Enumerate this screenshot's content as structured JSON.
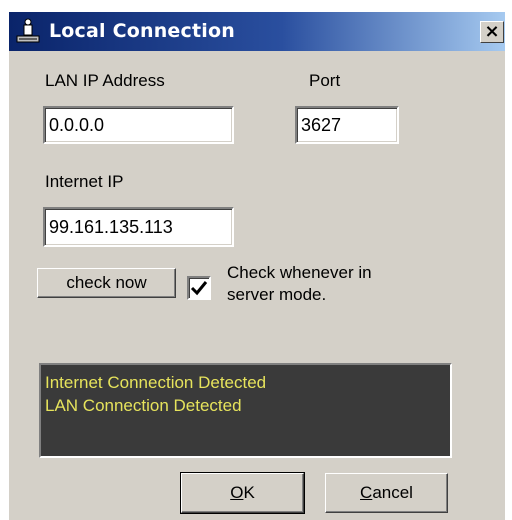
{
  "window": {
    "title": "Local Connection",
    "close_label": "×"
  },
  "lan": {
    "label": "LAN IP Address",
    "value": "0.0.0.0"
  },
  "port": {
    "label": "Port",
    "value": "3627"
  },
  "internet": {
    "label": "Internet IP",
    "value": "99.161.135.113"
  },
  "check_button": {
    "label": "check now"
  },
  "server_check": {
    "checked": true,
    "line1": "Check whenever in",
    "line2": "server mode."
  },
  "status": {
    "lines": [
      "Internet Connection Detected",
      "LAN Connection Detected"
    ],
    "bg_color": "#3a3a3a",
    "text_color": "#e6e35c"
  },
  "buttons": {
    "ok_mnemonic": "O",
    "ok_rest": "K",
    "cancel_mnemonic": "C",
    "cancel_rest": "ancel"
  },
  "icons": {
    "title": "network-computer-icon",
    "check": "checkmark-icon",
    "close": "close-icon"
  }
}
